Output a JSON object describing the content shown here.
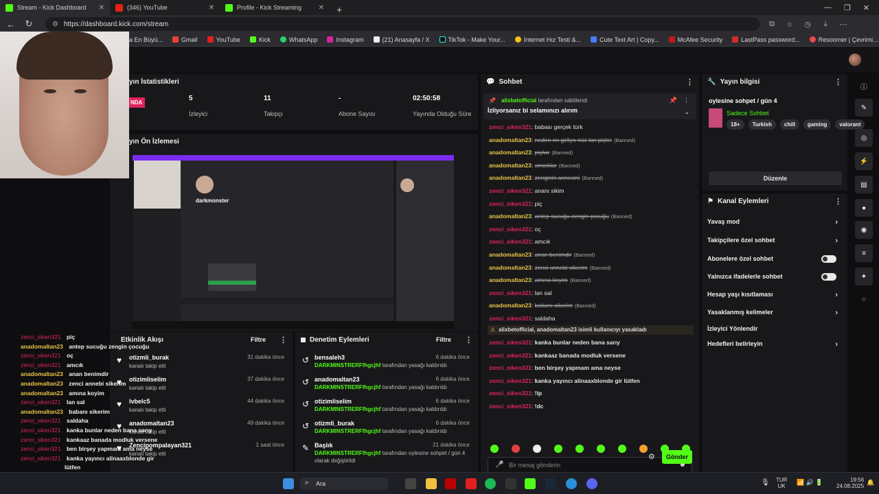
{
  "browser": {
    "tabs": [
      {
        "title": "Stream - Kick Dashboard",
        "active": true
      },
      {
        "title": "(346) YouTube",
        "active": false
      },
      {
        "title": "Profile - Kick Streaming",
        "active": false
      }
    ],
    "new_tab": "+",
    "url": "https://dashboard.kick.com/stream",
    "bookmarks": [
      "a En Büyü...",
      "Gmail",
      "YouTube",
      "Kick",
      "WhatsApp",
      "Instagram",
      "(21) Anasayfa / X",
      "TikTok - Make Your...",
      "İnternet Hız Testi &...",
      "Cute Text Art | Copy...",
      "McAfee Security",
      "LastPass password...",
      "Resoomer | Çevrimi..."
    ]
  },
  "stats": {
    "title": "yın İstatistikleri",
    "live_badge": "NDA",
    "items": [
      {
        "value": "5",
        "label": "İzleyici"
      },
      {
        "value": "11",
        "label": "Takipçi"
      },
      {
        "value": "-",
        "label": "Abone Sayısı"
      },
      {
        "value": "02:50:58",
        "label": "Yayında Olduğu Süre"
      }
    ]
  },
  "preview": {
    "title": "yın Ön İzlemesi",
    "channel": "darkmonster"
  },
  "activity": {
    "title": "Etkinlik Akışı",
    "filter": "Filtre",
    "items": [
      {
        "name": "otizmli_burak",
        "sub": "kanalı takip etti",
        "time": "31 dakika önce"
      },
      {
        "name": "otizimliselim",
        "sub": "kanalı takip etti",
        "time": "37 dakika önce"
      },
      {
        "name": "lvbelc5",
        "sub": "kanalı takip etti",
        "time": "44 dakika önce"
      },
      {
        "name": "anadomaltan23",
        "sub": "kanalı takip etti",
        "time": "49 dakika önce"
      },
      {
        "name": "Zencipompalayan321",
        "sub": "kanalı takip etti",
        "time": "1 saat önce"
      }
    ]
  },
  "moderation": {
    "title": "Denetim Eylemleri",
    "filter": "Filtre",
    "items": [
      {
        "name": "bensaleh3",
        "actor": "DARKMINSTRERFfhgcjhf",
        "action": "tarafından yasağı kaldırıldı",
        "time": "6 dakika önce"
      },
      {
        "name": "anadomaltan23",
        "actor": "DARKMINSTRERFfhgcjhf",
        "action": "tarafından yasağı kaldırıldı",
        "time": "6 dakika önce"
      },
      {
        "name": "otizimliselim",
        "actor": "DARKMINSTRERFfhgcjhf",
        "action": "tarafından yasağı kaldırıldı",
        "time": "6 dakika önce"
      },
      {
        "name": "otizmli_burak",
        "actor": "DARKMINSTRERFfhgcjhf",
        "action": "tarafından yasağı kaldırıldı",
        "time": "6 dakika önce"
      },
      {
        "name": "Başlık",
        "actor": "DARKMINSTRERFfhgcjhf",
        "action": "tarafından oylesine sohpet / gün 4",
        "action2": "olarak değiştirildi",
        "time": "21 dakika önce"
      }
    ]
  },
  "chat": {
    "title": "Sohbet",
    "pinned_by": "alixbetofficial",
    "pinned_by_suffix": "tarafından sabitlendi",
    "pinned_message": "İzliyorsanız bi selamınızı alırım",
    "messages": [
      {
        "user": "zenci_siken321",
        "text": "babası gerçek türk",
        "color": "red",
        "struck": false
      },
      {
        "user": "anadomaltan23",
        "text": "neden en geliyo nüz lan piçler",
        "color": "gold",
        "struck": true,
        "banned": "(Banned)"
      },
      {
        "user": "anadomaltan23",
        "text": "piçlwr",
        "color": "gold",
        "struck": true,
        "banned": "(Banned)"
      },
      {
        "user": "anadomaltan23",
        "text": "amcıklar",
        "color": "gold",
        "struck": true,
        "banned": "(Banned)"
      },
      {
        "user": "anadomaltan23",
        "text": "zenginin annesini",
        "color": "gold",
        "struck": true,
        "banned": "(Banned)"
      },
      {
        "user": "zenci_siken321",
        "text": "ananı sikim",
        "color": "red",
        "struck": false
      },
      {
        "user": "zenci_siken321",
        "text": "piç",
        "color": "red",
        "struck": false
      },
      {
        "user": "anadomaltan23",
        "text": "antep sucuğu zengin çocuğu",
        "color": "gold",
        "struck": true,
        "banned": "(Banned)"
      },
      {
        "user": "zenci_siken321",
        "text": "oç",
        "color": "red",
        "struck": false
      },
      {
        "user": "zenci_siken321",
        "text": "amcık",
        "color": "red",
        "struck": false
      },
      {
        "user": "anadomaltan23",
        "text": "anan benimdir",
        "color": "gold",
        "struck": true,
        "banned": "(Banned)"
      },
      {
        "user": "anadomaltan23",
        "text": "zenci annebi sikerim",
        "color": "gold",
        "struck": true,
        "banned": "(Banned)"
      },
      {
        "user": "anadomaltan23",
        "text": "amına koyim",
        "color": "gold",
        "struck": true,
        "banned": "(Banned)"
      },
      {
        "user": "zenci_siken321",
        "text": "lan sal",
        "color": "red",
        "struck": false
      },
      {
        "user": "anadomaltan23",
        "text": "babanı sikerim",
        "color": "gold",
        "struck": true,
        "banned": "(Banned)"
      },
      {
        "user": "zenci_siken321",
        "text": "saldaha",
        "color": "red",
        "struck": false
      }
    ],
    "system": "alixbetofficial, anadomaltan23 isimli kullanıcıyı yasakladı",
    "messages2": [
      {
        "user": "zenci_siken321",
        "text": "kanka bunlar neden bana sarıy"
      },
      {
        "user": "zenci_siken321",
        "text": "kankaaz banada modluk versene"
      },
      {
        "user": "zenci_siken321",
        "text": "ben birşey yapmam ama neyse"
      },
      {
        "user": "zenci_siken321",
        "text": "kanka yayıncı alinaaxblonde gir lütfen"
      },
      {
        "user": "zenci_siken321",
        "text": "!lp"
      },
      {
        "user": "zenci_siken321",
        "text": "!dc"
      }
    ],
    "input_placeholder": "Bir mesaj gönderin",
    "send": "Gönder"
  },
  "overlay_chat": [
    {
      "user": "zenci_siken321",
      "text": "piç",
      "color": "red"
    },
    {
      "user": "anadomaltan23",
      "text": "antep sucuğu zengin çocuğu",
      "color": "gold"
    },
    {
      "user": "zenci_siken321",
      "text": "oç",
      "color": "red"
    },
    {
      "user": "zenci_siken321",
      "text": "amcık",
      "color": "red"
    },
    {
      "user": "anadomaltan23",
      "text": "anan benimdir",
      "color": "gold"
    },
    {
      "user": "anadomaltan23",
      "text": "zenci annebi sikerim",
      "color": "gold"
    },
    {
      "user": "anadomaltan23",
      "text": "amına koyim",
      "color": "gold"
    },
    {
      "user": "zenci_siken321",
      "text": "lan sal",
      "color": "red"
    },
    {
      "user": "anadomaltan23",
      "text": "babanı sikerim",
      "color": "gold"
    },
    {
      "user": "zenci_siken321",
      "text": "saldaha",
      "color": "red"
    },
    {
      "user": "zenci_siken321",
      "text": "kanka bunlar neden bana sarıy",
      "color": "red"
    },
    {
      "user": "zenci_siken321",
      "text": "kankaaz banada modluk versene",
      "color": "red"
    },
    {
      "user": "zenci_siken321",
      "text": "ben birşey yapmam ama neyse",
      "color": "red"
    },
    {
      "user": "zenci_siken321",
      "text": "kanka yayıncı alinaaxblonde gir",
      "color": "red"
    },
    {
      "user": "",
      "text": "lütfen",
      "color": "red"
    },
    {
      "user": "zenci_siken321",
      "text": "!lp",
      "color": "red"
    },
    {
      "user": "zenci_siken321",
      "text": "!dc",
      "color": "red"
    }
  ],
  "stream_info": {
    "title": "Yayın bilgisi",
    "stream_title": "oylesine sohpet / gün 4",
    "category": "Sadece Sohbet",
    "tags": [
      "18+",
      "Turkish",
      "chill",
      "gaming",
      "valorant"
    ],
    "edit": "Düzenle"
  },
  "channel_actions": {
    "title": "Kanal Eylemleri",
    "items": [
      {
        "label": "Yavaş mod",
        "kind": "chevron"
      },
      {
        "label": "Takipçilere özel sohbet",
        "kind": "chevron"
      },
      {
        "label": "Abonelere özel sohbet",
        "kind": "toggle"
      },
      {
        "label": "Yalnızca ifadelerle sohbet",
        "kind": "toggle"
      },
      {
        "label": "Hesap yaşı kısıtlaması",
        "kind": "chevron"
      },
      {
        "label": "Yasaklanmış kelimeler",
        "kind": "chevron"
      },
      {
        "label": "İzleyici Yönlendir",
        "kind": "none"
      },
      {
        "label": "Hedefleri belirleyin",
        "kind": "chevron"
      }
    ]
  },
  "taskbar": {
    "search": "Ara",
    "lang": "TUR",
    "lang2": "UK",
    "time": "19:56",
    "date": "24.08.2025"
  },
  "colors": {
    "accent": "#53fc18",
    "danger": "#e0245e",
    "panel": "#18181b"
  }
}
